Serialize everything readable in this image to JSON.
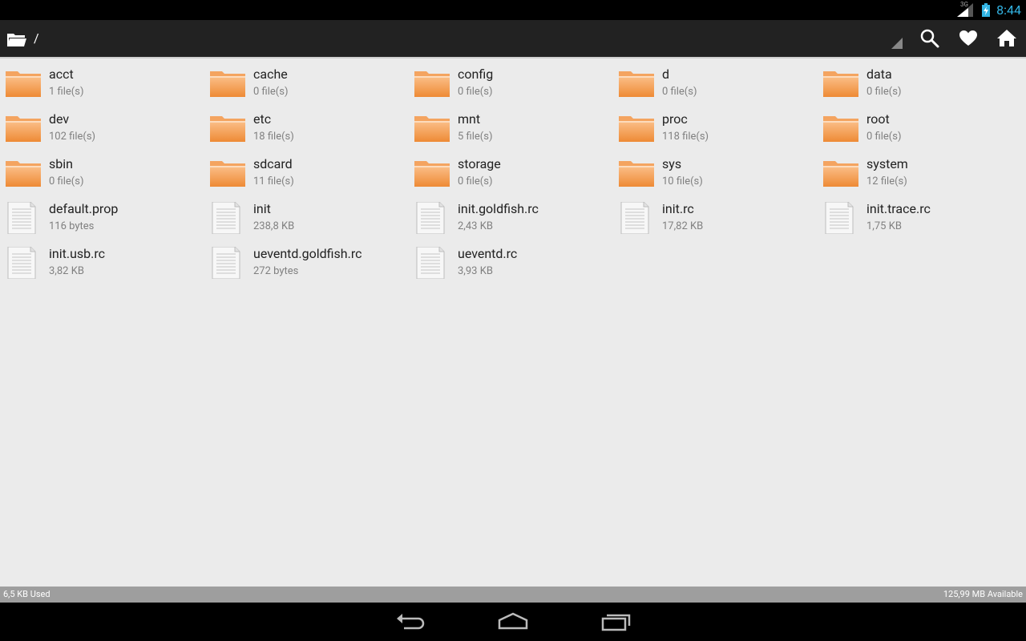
{
  "status_bar": {
    "network": "3G",
    "time": "8:44"
  },
  "action_bar": {
    "path": "/",
    "icons": {
      "folder": "folder-open-icon",
      "search": "search-icon",
      "favorite": "heart-icon",
      "home": "home-icon"
    }
  },
  "colors": {
    "folder": "#f39a4a",
    "accent": "#33b5e5",
    "action_bar": "#222222"
  },
  "files": [
    {
      "name": "acct",
      "info": "1 file(s)",
      "type": "folder"
    },
    {
      "name": "cache",
      "info": "0 file(s)",
      "type": "folder"
    },
    {
      "name": "config",
      "info": "0 file(s)",
      "type": "folder"
    },
    {
      "name": "d",
      "info": "0 file(s)",
      "type": "folder"
    },
    {
      "name": "data",
      "info": "0 file(s)",
      "type": "folder"
    },
    {
      "name": "dev",
      "info": "102 file(s)",
      "type": "folder"
    },
    {
      "name": "etc",
      "info": "18 file(s)",
      "type": "folder"
    },
    {
      "name": "mnt",
      "info": "5 file(s)",
      "type": "folder"
    },
    {
      "name": "proc",
      "info": "118 file(s)",
      "type": "folder"
    },
    {
      "name": "root",
      "info": "0 file(s)",
      "type": "folder"
    },
    {
      "name": "sbin",
      "info": "0 file(s)",
      "type": "folder"
    },
    {
      "name": "sdcard",
      "info": "11 file(s)",
      "type": "folder"
    },
    {
      "name": "storage",
      "info": "0 file(s)",
      "type": "folder"
    },
    {
      "name": "sys",
      "info": "10 file(s)",
      "type": "folder"
    },
    {
      "name": "system",
      "info": "12 file(s)",
      "type": "folder"
    },
    {
      "name": "default.prop",
      "info": "116 bytes",
      "type": "file"
    },
    {
      "name": "init",
      "info": "238,8 KB",
      "type": "file"
    },
    {
      "name": "init.goldfish.rc",
      "info": "2,43 KB",
      "type": "file"
    },
    {
      "name": "init.rc",
      "info": "17,82 KB",
      "type": "file"
    },
    {
      "name": "init.trace.rc",
      "info": "1,75 KB",
      "type": "file"
    },
    {
      "name": "init.usb.rc",
      "info": "3,82 KB",
      "type": "file"
    },
    {
      "name": "ueventd.goldfish.rc",
      "info": "272 bytes",
      "type": "file"
    },
    {
      "name": "ueventd.rc",
      "info": "3,93 KB",
      "type": "file"
    }
  ],
  "storage": {
    "used": "6,5 KB Used",
    "available": "125,99 MB Available"
  },
  "nav_bar": {
    "icons": {
      "back": "back-icon",
      "home": "home-nav-icon",
      "recent": "recent-apps-icon"
    }
  }
}
